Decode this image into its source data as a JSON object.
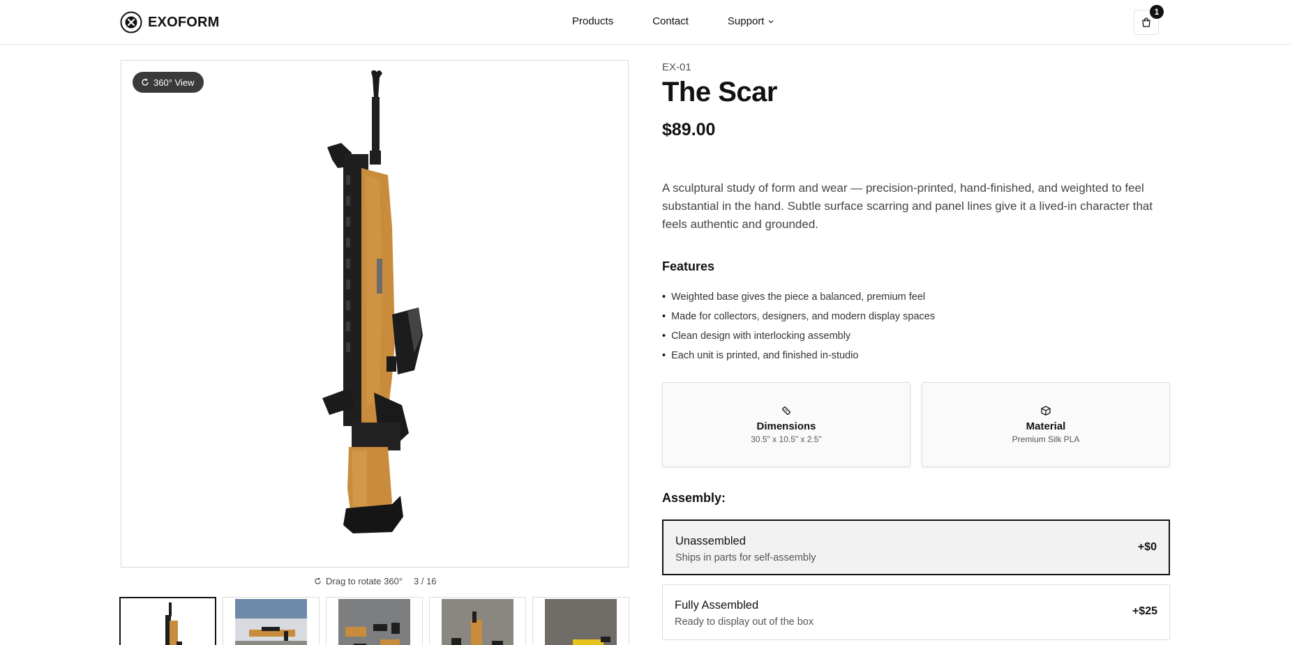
{
  "brand": {
    "name": "EXOFORM",
    "logo_icon": "exoform-logo-icon"
  },
  "nav": {
    "products": "Products",
    "contact": "Contact",
    "support": "Support"
  },
  "cart": {
    "icon": "shopping-bag-icon",
    "count": "1"
  },
  "viewer": {
    "view_pill": "360° View",
    "rotate_hint": "Drag to rotate 360°",
    "frame_counter": "3 / 16"
  },
  "thumbnails": {
    "count": 5,
    "active_index": 0
  },
  "product": {
    "sku": "EX-01",
    "title": "The Scar",
    "price": "$89.00",
    "description": "A sculptural study of form and wear — precision-printed, hand-finished, and weighted to feel substantial in the hand. Subtle surface scarring and panel lines give it a lived-in character that feels authentic and grounded.",
    "features_heading": "Features",
    "features": [
      "Weighted base gives the piece a balanced, premium feel",
      "Made for collectors, designers, and modern display spaces",
      "Clean design with interlocking assembly",
      "Each unit is printed, and finished in-studio"
    ]
  },
  "specs": [
    {
      "label": "Dimensions",
      "value": "30.5\" x 10.5\" x 2.5\"",
      "icon": "ruler-icon"
    },
    {
      "label": "Material",
      "value": "Premium Silk PLA",
      "icon": "box-icon"
    }
  ],
  "assembly": {
    "heading": "Assembly:",
    "options": [
      {
        "name": "Unassembled",
        "sub": "Ships in parts for self-assembly",
        "price": "+$0",
        "selected": true
      },
      {
        "name": "Fully Assembled",
        "sub": "Ready to display out of the box",
        "price": "+$25",
        "selected": false
      }
    ]
  },
  "colors": {
    "accent": "#111111",
    "product_orange": "#c98c3c",
    "pill_bg": "#3a3a3a"
  }
}
